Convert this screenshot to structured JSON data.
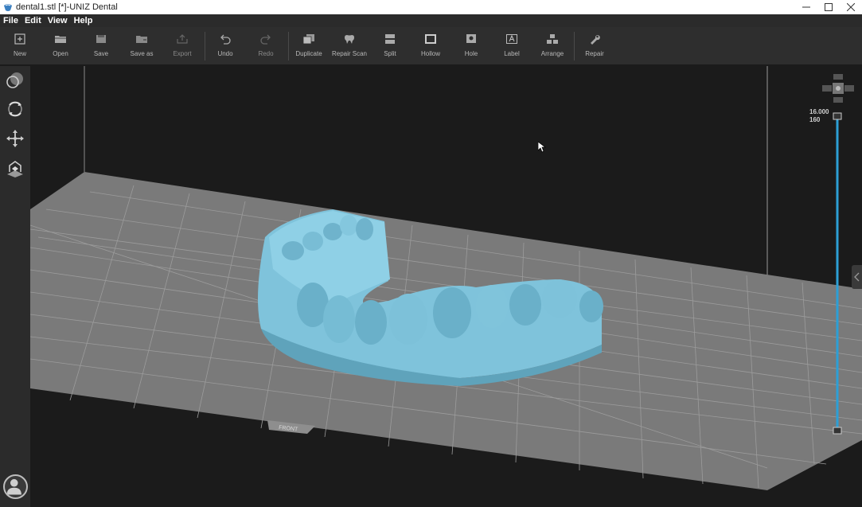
{
  "window": {
    "title": "dental1.stl [*]-UNIZ Dental",
    "controls": [
      "minimize",
      "maximize",
      "close"
    ]
  },
  "menu": {
    "items": [
      "File",
      "Edit",
      "View",
      "Help"
    ]
  },
  "toolbar": {
    "new": "New",
    "open": "Open",
    "save": "Save",
    "save_as": "Save as",
    "export": "Export",
    "undo": "Undo",
    "redo": "Redo",
    "duplicate": "Duplicate",
    "repair_scan": "Repair Scan",
    "split": "Split",
    "hollow": "Hollow",
    "hole": "Hole",
    "label": "Label",
    "arrange": "Arrange",
    "repair": "Repair"
  },
  "sidebar": {
    "tools": [
      "view-mode-icon",
      "rotate-icon",
      "move-icon",
      "platform-icon"
    ],
    "user": "user-avatar-icon"
  },
  "viewport": {
    "platform_label": "FRONT",
    "model_color": "#7fc3db",
    "platform_color": "#777777",
    "slider_color": "#2c9fd6"
  },
  "layer_slider": {
    "height_value": "16.000",
    "layer_value": "160"
  }
}
